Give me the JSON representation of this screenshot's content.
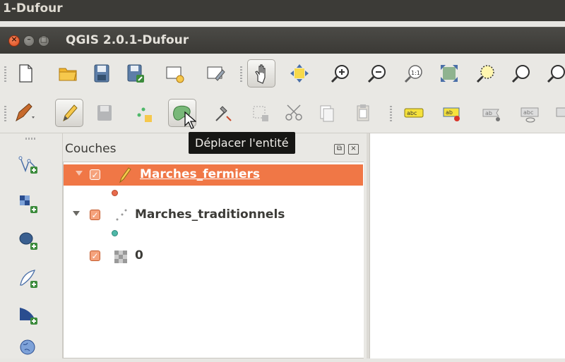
{
  "os_bar": {
    "title": "1-Dufour"
  },
  "window": {
    "title": "QGIS 2.0.1-Dufour",
    "close": "×",
    "minimize": "–",
    "maximize": "□"
  },
  "toolbar_file": [
    "new-project-icon",
    "open-project-icon",
    "save-project-icon",
    "save-as-icon",
    "new-print-composer-icon",
    "composer-manager-icon",
    "pan-map-icon",
    "pan-to-selection-icon",
    "zoom-in-icon",
    "zoom-out-icon",
    "zoom-actual-size-icon",
    "zoom-full-icon",
    "zoom-to-selection-icon",
    "zoom-to-layer-icon",
    "zoom-last-icon"
  ],
  "toolbar_edit": [
    "current-edits-icon",
    "toggle-editing-icon",
    "save-edits-icon",
    "add-feature-icon",
    "move-feature-icon",
    "node-tool-icon",
    "delete-selected-icon",
    "cut-features-icon",
    "copy-features-icon",
    "paste-features-icon",
    "label-tool-icon",
    "pin-labels-icon",
    "show-hide-labels-icon",
    "move-label-icon",
    "rotate-label-icon"
  ],
  "label_toolbar": {
    "abc": "abc",
    "ab": "ab"
  },
  "layer_tools": [
    "add-vector-layer-icon",
    "add-raster-layer-icon",
    "add-postgis-layer-icon",
    "add-spatialite-layer-icon",
    "add-mssql-layer-icon",
    "add-wms-layer-icon"
  ],
  "layers_panel": {
    "title": "Couches",
    "float_glyph": "⧉",
    "close_glyph": "×",
    "checkmark": "✓",
    "layers": [
      {
        "name": "Marches_fermiers",
        "selected": true,
        "symbol_color": "#e86a4c"
      },
      {
        "name": "Marches_traditionnels",
        "selected": false,
        "symbol_color": "#4fb8a8"
      },
      {
        "name": "0",
        "selected": false,
        "symbol_color": ""
      }
    ]
  },
  "tooltip": {
    "text": "Déplacer l'entité"
  },
  "colors": {
    "accent": "#f07746",
    "titlebar": "#3c3b37"
  }
}
